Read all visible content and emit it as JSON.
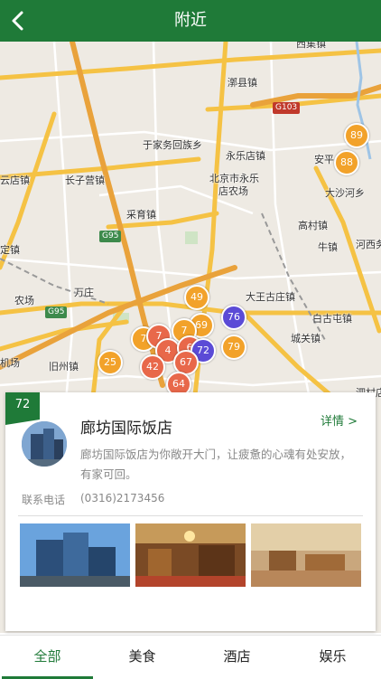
{
  "header": {
    "title": "附近",
    "back_icon": "chevron-left-icon"
  },
  "map": {
    "labels": [
      "西集镇",
      "漷县镇",
      "于家务回族乡",
      "永乐店镇",
      "安平",
      "云店镇",
      "长子营镇",
      "北京市永乐",
      "店农场",
      "大沙河乡",
      "采育镇",
      "高村镇",
      "定镇",
      "牛镇",
      "河西务",
      "农场",
      "万庄",
      "大王古庄镇",
      "白古屯镇",
      "城关镇",
      "机场",
      "旧州镇",
      "泗村店"
    ],
    "road_badges": [
      "G103",
      "G95",
      "G95"
    ],
    "clusters": [
      "89",
      "88",
      "49",
      "76",
      "69",
      "72",
      "79",
      "25",
      "42",
      "4",
      "6",
      "67",
      "64",
      "7"
    ]
  },
  "card": {
    "tag": "72",
    "name": "廊坊国际饭店",
    "details_label": "详情 >",
    "description": "廊坊国际饭店为你敞开大门，让疲惫的心魂有处安放，有家可回。",
    "phone_label": "联系电话",
    "phone": "(0316)2173456"
  },
  "tabs": [
    {
      "label": "全部",
      "active": true
    },
    {
      "label": "美食",
      "active": false
    },
    {
      "label": "酒店",
      "active": false
    },
    {
      "label": "娱乐",
      "active": false
    }
  ],
  "colors": {
    "brand": "#1f7a38",
    "cluster_orange": "#f2a22a",
    "cluster_red": "#e8684a",
    "cluster_purple": "#5b4bd6"
  }
}
